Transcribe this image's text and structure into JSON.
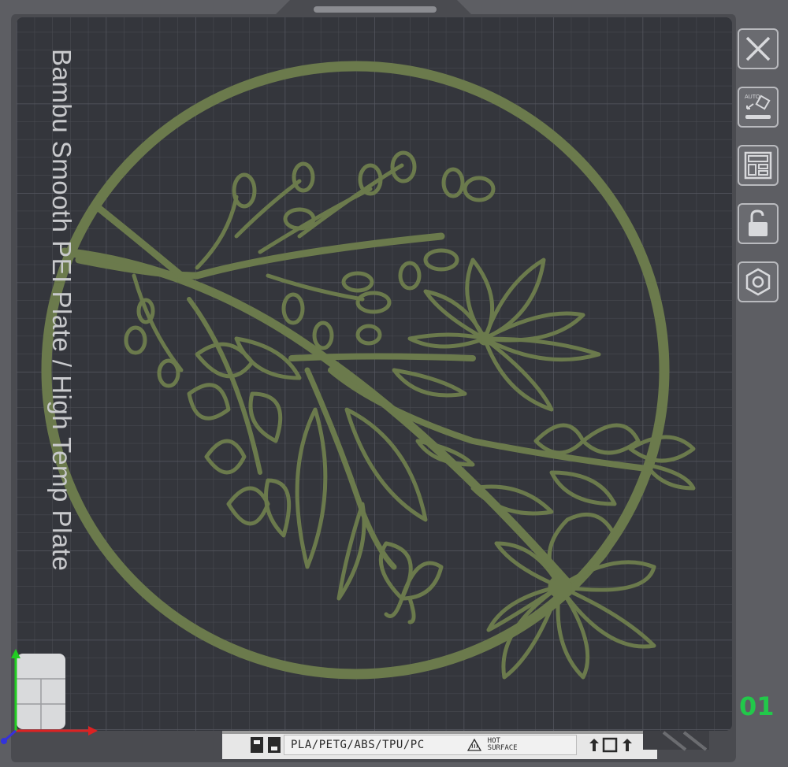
{
  "plate": {
    "name": "Bambu Smooth PEI Plate / High Temp Plate",
    "number": "01",
    "material_label": "PLA/PETG/ABS/TPU/PC",
    "hot_line1": "HOT",
    "hot_line2": "SURFACE",
    "model_color": "#6b7a4c",
    "bed_color": "#35373d",
    "grid_color": "#4a4c53",
    "frame_color": "#5d5e63"
  },
  "toolbar": {
    "items": [
      {
        "name": "close",
        "icon": "close-icon"
      },
      {
        "name": "auto-orient",
        "icon": "auto-orient-icon"
      },
      {
        "name": "arrange",
        "icon": "arrange-icon"
      },
      {
        "name": "lock",
        "icon": "lock-open-icon"
      },
      {
        "name": "settings",
        "icon": "hex-settings-icon"
      }
    ]
  }
}
